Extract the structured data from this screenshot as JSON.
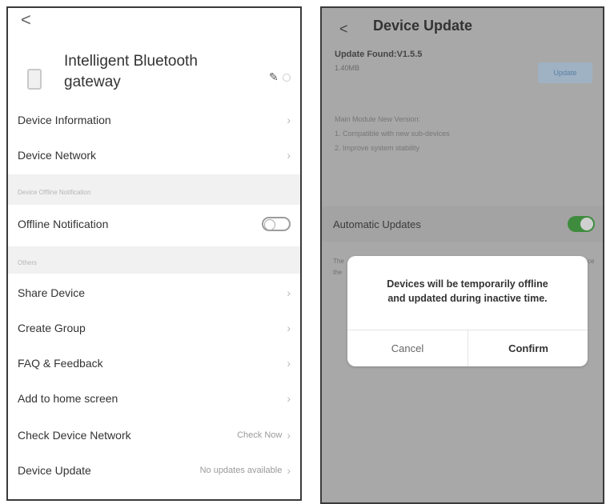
{
  "left": {
    "back_glyph": "<",
    "device_name": "Intelligent Bluetooth gateway",
    "rows_top": [
      {
        "label": "Device Information",
        "chev": "›"
      },
      {
        "label": "Device Network",
        "chev": "›"
      }
    ],
    "section_offline": "Device Offline Notification",
    "offline_label": "Offline Notification",
    "section_others": "Others",
    "rows_others": [
      {
        "label": "Share Device",
        "chev": "›"
      },
      {
        "label": "Create Group",
        "chev": "›"
      },
      {
        "label": "FAQ & Feedback",
        "chev": "›"
      },
      {
        "label": "Add to home screen",
        "chev": "›"
      },
      {
        "label": "Check Device Network",
        "value": "Check Now",
        "chev": "›"
      },
      {
        "label": "Device Update",
        "value": "No updates available",
        "chev": "›"
      }
    ]
  },
  "right": {
    "back_glyph": "<",
    "title": "Device Update",
    "update_found": "Update Found:V1.5.5",
    "size": "1.40MB",
    "update_button": "Update",
    "notes": [
      "Main Module New Version:",
      "1. Compatible with new sub-devices",
      "2. Improve system stability"
    ],
    "auto_label": "Automatic Updates",
    "hidden_text_1": "The",
    "hidden_text_2": "the",
    "hidden_text_3": "ce",
    "dialog": {
      "message_line1": "Devices will be temporarily offline",
      "message_line2": "and updated during inactive time.",
      "cancel": "Cancel",
      "confirm": "Confirm"
    }
  }
}
